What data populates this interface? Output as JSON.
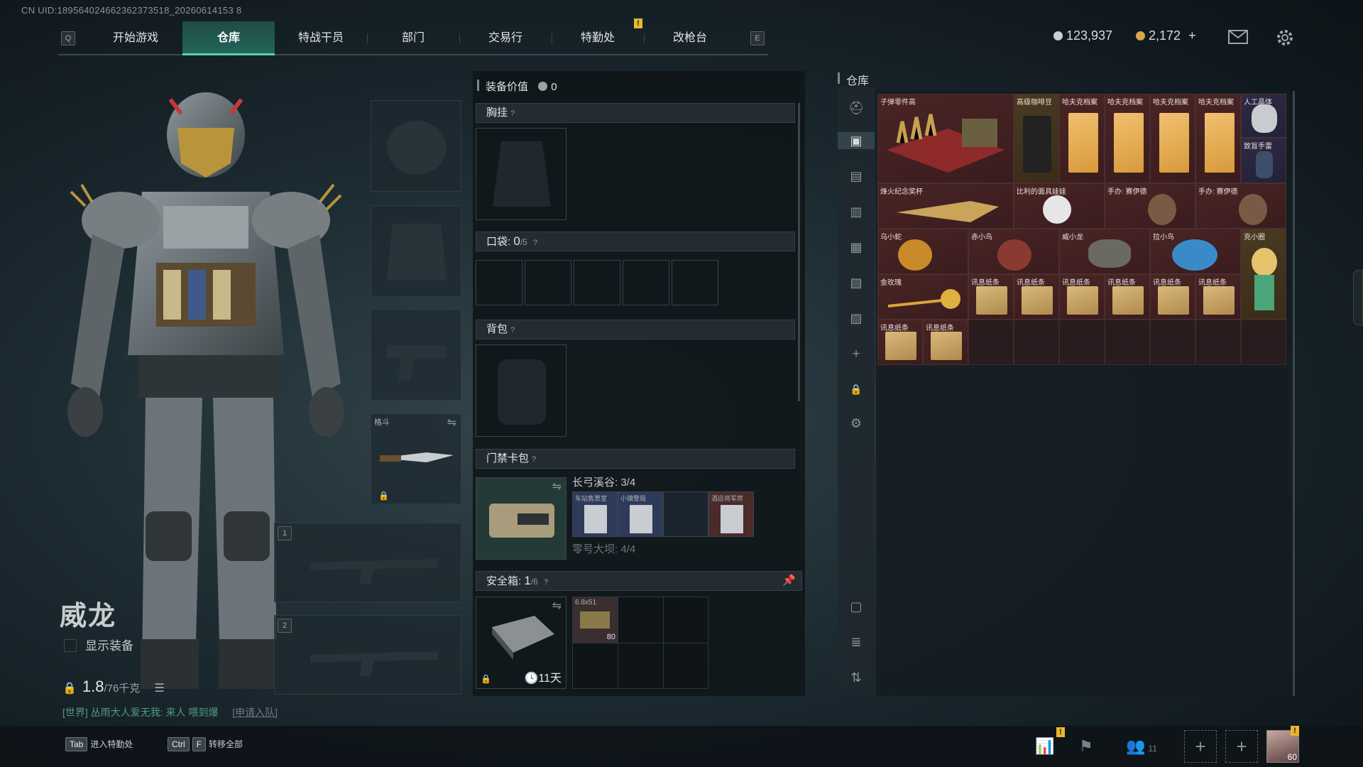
{
  "uid": "CN UID:189564024662362373518_20260614153 8",
  "nav": {
    "left_key": "Q",
    "right_key": "E",
    "tabs": [
      "开始游戏",
      "仓库",
      "特战干员",
      "部门",
      "交易行",
      "特勤处",
      "改枪台"
    ],
    "active_tab": "仓库"
  },
  "currency": {
    "silver": "123,937",
    "gold": "2,172",
    "plus": "+"
  },
  "character": {
    "name": "威龙",
    "show_equipment_label": "显示装备",
    "weight": "1.8",
    "weight_max": "/76千克"
  },
  "chat": {
    "text": "[世界] 丛雨大人爱无我: 来人 喂到爆",
    "link": "[申请入队]"
  },
  "slots": {
    "melee_label": "格斗",
    "slot1": "1",
    "slot2": "2"
  },
  "equipment": {
    "value_label": "装备价值",
    "value": "0",
    "chest_rig": "胸挂",
    "pockets_label": "口袋:",
    "pockets_count": "0",
    "pockets_max": "/5",
    "backpack": "背包",
    "keycard_label": "门禁卡包",
    "keycard_map1": "长弓溪谷: 3/4",
    "keycard_map2": "零号大坝: 4/4",
    "keycard_items": [
      "车站售票室",
      "小镇警局",
      "",
      "酒店将军房"
    ],
    "safe_label": "安全箱:",
    "safe_count": "1",
    "safe_max": "/6",
    "safe_timer": "11天",
    "ammo_label": "6.8x51",
    "ammo_count": "80",
    "help": "?"
  },
  "warehouse": {
    "title": "仓库",
    "items": {
      "bullet_parts": "子弹零件高",
      "coffee": "高级咖啡豆",
      "hafk1": "哈夫克档案",
      "hafk2": "哈夫克档案",
      "hafk3": "哈夫克档案",
      "hafk4": "哈夫克档案",
      "meteor": "人工晶体",
      "grenade": "致盲手雷",
      "trophy": "烽火纪念奖杯",
      "puppet": "比利的面具娃娃",
      "figure1": "手办: 赛伊德",
      "figure2": "手办: 赛伊德",
      "wuxiaoshe": "乌小蛇",
      "chixiaoniao": "赤小鸟",
      "weixiaolong": "威小龙",
      "laxiaoyue": "拉小鸟",
      "kexiaomiao": "克小圈",
      "rose": "金玫瑰",
      "paper": "讯息纸条"
    }
  },
  "bottom": {
    "tab_key": "Tab",
    "tab_label": "进入特勤处",
    "ctrl_key": "Ctrl",
    "f_key": "F",
    "transfer_label": "转移全部",
    "friends_count": "11",
    "avatar_level": "60",
    "warn": "!"
  }
}
